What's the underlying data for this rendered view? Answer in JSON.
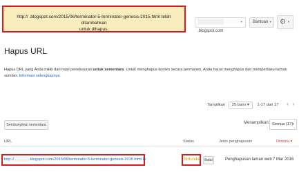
{
  "notice": {
    "line1": "http://          .blogspot.com/2015/06/terminator-5-terminator-genesis-2015.html telah ditambahkan",
    "line2": "untuk dihapus."
  },
  "header": {
    "site_selector": ".blogspot.com",
    "help_label": "Bantuan",
    "caret": "▾",
    "gear": "⚙"
  },
  "page": {
    "title": "Hapus URL",
    "description_pre": "Hapus URL yang Anda miliki dari hasil penelusuran ",
    "description_bold": "untuk sementara",
    "description_post": ". Untuk menghapus konten secara permanen, Anda harus menghapus dan memperbarui laman sumber. ",
    "description_link": "Informasi selengkapnya"
  },
  "pager": {
    "show_label": "Tampilkan",
    "rows_option": "25 baris",
    "range": "1-17 dari 17",
    "prev": "‹",
    "next": "›"
  },
  "toolbar": {
    "hide_button": "Sembunyikan sementara",
    "filter_label": "Menampilkan:",
    "filter_value": "Semua (17)"
  },
  "table": {
    "headers": {
      "url": "URL",
      "status": "Status",
      "type": "Jenis penghapusan",
      "requested": "Diminta ▾"
    },
    "rows": [
      {
        "url_prefix": "http://",
        "url_rest": ".blogspot.com/2015/06/terminator-5-terminator-genesis-2015.html",
        "external": "⧉",
        "status": "Tertunda",
        "cancel": "Batal",
        "type": "Penghapusan laman web",
        "date": "7 Mar 2016"
      }
    ]
  }
}
